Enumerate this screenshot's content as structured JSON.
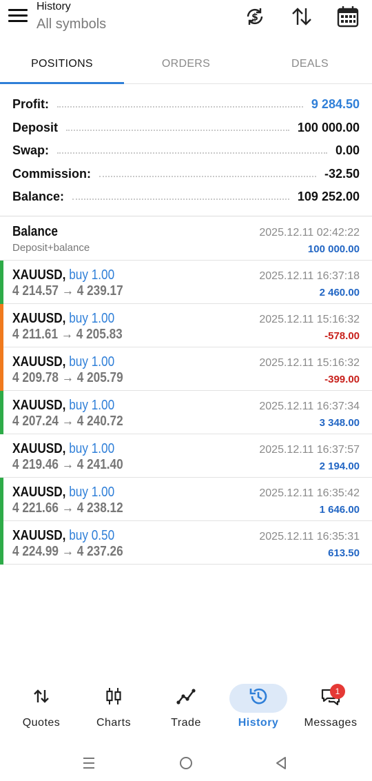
{
  "header": {
    "title": "History",
    "subtitle": "All symbols",
    "icons": [
      "menu-icon",
      "currency-exchange-icon",
      "sort-icon",
      "calendar-icon"
    ]
  },
  "tabs": [
    {
      "label": "POSITIONS",
      "active": true
    },
    {
      "label": "ORDERS",
      "active": false
    },
    {
      "label": "DEALS",
      "active": false
    }
  ],
  "summary": {
    "profit": {
      "label": "Profit:",
      "value": "9 284.50"
    },
    "deposit": {
      "label": "Deposit",
      "value": "100 000.00"
    },
    "swap": {
      "label": "Swap:",
      "value": "0.00"
    },
    "commission": {
      "label": "Commission:",
      "value": "-32.50"
    },
    "balance": {
      "label": "Balance:",
      "value": "109 252.00"
    }
  },
  "balance_entry": {
    "title": "Balance",
    "subtitle": "Deposit+balance",
    "time": "2025.12.11 02:42:22",
    "amount": "100 000.00"
  },
  "deals": [
    {
      "symbol": "XAUUSD,",
      "type": "buy 1.00",
      "open": "4 214.57",
      "close": "4 239.17",
      "time": "2025.12.11 16:37:18",
      "profit": "2 460.00"
    },
    {
      "symbol": "XAUUSD,",
      "type": "buy 1.00",
      "open": "4 211.61",
      "close": "4 205.83",
      "time": "2025.12.11 15:16:32",
      "profit": "-578.00"
    },
    {
      "symbol": "XAUUSD,",
      "type": "buy 1.00",
      "open": "4 209.78",
      "close": "4 205.79",
      "time": "2025.12.11 15:16:32",
      "profit": "-399.00"
    },
    {
      "symbol": "XAUUSD,",
      "type": "buy 1.00",
      "open": "4 207.24",
      "close": "4 240.72",
      "time": "2025.12.11 16:37:34",
      "profit": "3 348.00"
    },
    {
      "symbol": "XAUUSD,",
      "type": "buy 1.00",
      "open": "4 219.46",
      "close": "4 241.40",
      "time": "2025.12.11 16:37:57",
      "profit": "2 194.00"
    },
    {
      "symbol": "XAUUSD,",
      "type": "buy 1.00",
      "open": "4 221.66",
      "close": "4 238.12",
      "time": "2025.12.11 16:35:42",
      "profit": "1 646.00"
    },
    {
      "symbol": "XAUUSD,",
      "type": "buy 0.50",
      "open": "4 224.99",
      "close": "4 237.26",
      "time": "2025.12.11 16:35:31",
      "profit": "613.50"
    }
  ],
  "arrow": "→",
  "colors": {
    "accent": "#2f7fd8",
    "profit": "#2266c4",
    "loss": "#c8211c",
    "bar_green": "#2eab48",
    "bar_orange": "#f07a1d"
  },
  "row_bars": [
    "green",
    "orange",
    "orange",
    "green",
    "none",
    "green",
    "green"
  ],
  "bottom_nav": [
    {
      "label": "Quotes",
      "icon": "quotes-arrows-icon",
      "active": false
    },
    {
      "label": "Charts",
      "icon": "candlestick-icon",
      "active": false
    },
    {
      "label": "Trade",
      "icon": "trend-line-icon",
      "active": false
    },
    {
      "label": "History",
      "icon": "history-clock-icon",
      "active": true
    },
    {
      "label": "Messages",
      "icon": "chat-icon",
      "active": false,
      "badge": "1"
    }
  ],
  "system_nav": [
    "recents-icon",
    "home-icon",
    "back-icon"
  ]
}
